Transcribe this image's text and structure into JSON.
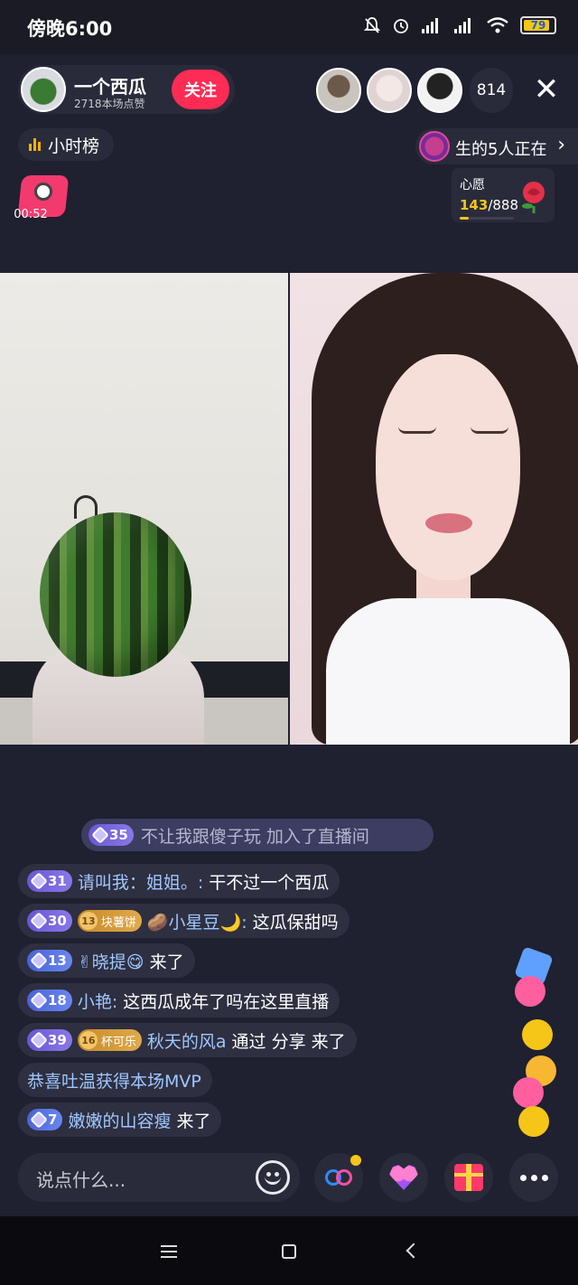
{
  "status_bar": {
    "time": "傍晚6:00",
    "battery": "79"
  },
  "host": {
    "name": "一个西瓜",
    "likes": "2718本场点赞",
    "follow_label": "关注"
  },
  "viewers": {
    "count": "814"
  },
  "rank": {
    "label": "小时榜"
  },
  "notice": {
    "text": "生的5人正在"
  },
  "timer": {
    "text": "00:52"
  },
  "wish": {
    "label": "心愿",
    "current": "143",
    "target": "/888",
    "progress": 0.16
  },
  "chat": {
    "join": {
      "level": "35",
      "text": "不让我跟傻子玩 加入了直播间"
    },
    "messages": [
      {
        "level": "31",
        "user": "请叫我：姐姐。:",
        "text": "干不过一个西瓜"
      },
      {
        "level": "30",
        "fan_level": "13",
        "fan_name": "块薯饼",
        "user": "🥔小星豆🌙:",
        "text": "这瓜保甜吗"
      },
      {
        "level": "13",
        "user": "✌晓提😋",
        "text": "来了"
      },
      {
        "level": "18",
        "user": "小艳:",
        "text": "这西瓜成年了吗在这里直播"
      },
      {
        "level": "39",
        "fan_level": "16",
        "fan_name": "杯可乐",
        "user": "秋天的风a",
        "text": "通过 分享 来了"
      },
      {
        "system": "恭喜吐温获得本场MVP"
      },
      {
        "level": "7",
        "user": "嫩嫩的山容瘦",
        "text": "来了"
      }
    ]
  },
  "input": {
    "placeholder": "说点什么..."
  },
  "icons": {
    "close": "close-icon",
    "emoji": "smiley-icon",
    "link": "link-icon",
    "heart": "heart-icon",
    "gift": "gift-icon",
    "more": "more-icon"
  },
  "colors": {
    "follow": "#fe2c55",
    "accent": "#f5c518",
    "background": "#1f2030"
  }
}
